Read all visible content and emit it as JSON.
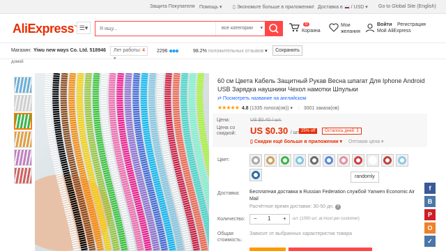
{
  "topbar": {
    "buyer_protection": "Защита Покупателя",
    "help": "Помощь",
    "save_more_app": "Экономьте больше в приложении!",
    "ship_to": "Доставка в",
    "currency": "USD",
    "global_site": "Go to Global Site (English)"
  },
  "header": {
    "logo": "AliExpress",
    "search_placeholder": "Я ищу...",
    "category": "все категории",
    "cart_count": "0",
    "cart_label": "Корзина",
    "wishlist": "Мои желания",
    "sign_in": "Войти",
    "register": "Регистрация",
    "my_ali": "Мой AliExpress"
  },
  "store": {
    "label": "Магазин:",
    "name": "Yiwu new ways Co. Ltd. 518946",
    "years_label": "Лет работы:",
    "years": "4",
    "score": "2296",
    "positive": "98.2%",
    "positive_label": "положительных отзывов",
    "save_button": "Сохранить"
  },
  "breadcrumb": "домой",
  "product": {
    "title": "60 см Цвета Кабель Защитный Рукав Весна шпагат Для Iphone Android USB Зарядка наушники Чехол намотки Шпульки",
    "view_english": "Посмотреть название на английском",
    "rating_stars": "★★★★★",
    "rating": "4.8",
    "reviews": "(1335 голоса(ов))",
    "orders": "3001 заказа(ов)"
  },
  "price": {
    "price_label": "Цена:",
    "old_price": "US $0.40 / шт.",
    "discount_label": "Цена со скидкой:",
    "new_price": "US $0.30",
    "unit": "/ шт.",
    "off": "25% off",
    "days_left": "Осталось дней: 3",
    "app_deal": "Скидки ещё больше в приложении",
    "wholesale": "Оптовая цена"
  },
  "options": {
    "color_label": "Цвет:",
    "swatch_colors": [
      "#a9a9a9",
      "#d0a060",
      "#3cb44b",
      "#7ec8e3",
      "#6a6a6a",
      "#5b8bd9",
      "#e58fa0",
      "#d04040",
      "#ffffff",
      "#c04040",
      "#8fc9e8",
      "#2a6fa8"
    ],
    "randomly": "randomly",
    "ship_label": "Доставка:",
    "ship_text": "Бесплатная доставка в Russian Federation службой Yanwen Economic Air Mail",
    "ship_time": "Расчётное время доставки: 30-50 дн.",
    "qty_label": "Количество:",
    "qty_minus": "−",
    "qty_value": "1",
    "qty_plus": "+",
    "qty_info": "шт. (1000 шт. at most per customer)",
    "total_label": "Общая стоимость:",
    "total_text": "Зависит от выбранных характеристик товара"
  },
  "thumbs": [
    "#6ab0d8",
    "#cfcfcf",
    "#3cb44b",
    "#e0a040",
    "#c080c0",
    "#d06060"
  ],
  "cable_colors": [
    "#ffffff",
    "#000000",
    "#8b4513",
    "#ff8c00",
    "#ffd700",
    "#9acd32",
    "#32cd32",
    "#ffffff",
    "#ff69b4",
    "#ff1493",
    "#9370db",
    "#4169e1",
    "#00bfff",
    "#87ceeb",
    "#ffffff",
    "#dc143c",
    "#ff6347",
    "#40e0d0",
    "#7fffd4",
    "#adff2f"
  ],
  "share": [
    {
      "icon": "facebook-icon",
      "glyph": "f",
      "color": "#3b5998"
    },
    {
      "icon": "vk-icon",
      "glyph": "B",
      "color": "#4a76a8"
    },
    {
      "icon": "pinterest-icon",
      "glyph": "P",
      "color": "#cb2027"
    },
    {
      "icon": "odnoklassniki-icon",
      "glyph": "O",
      "color": "#ed812b"
    },
    {
      "icon": "vk-share-icon",
      "glyph": "✓",
      "color": "#4a76a8"
    }
  ]
}
